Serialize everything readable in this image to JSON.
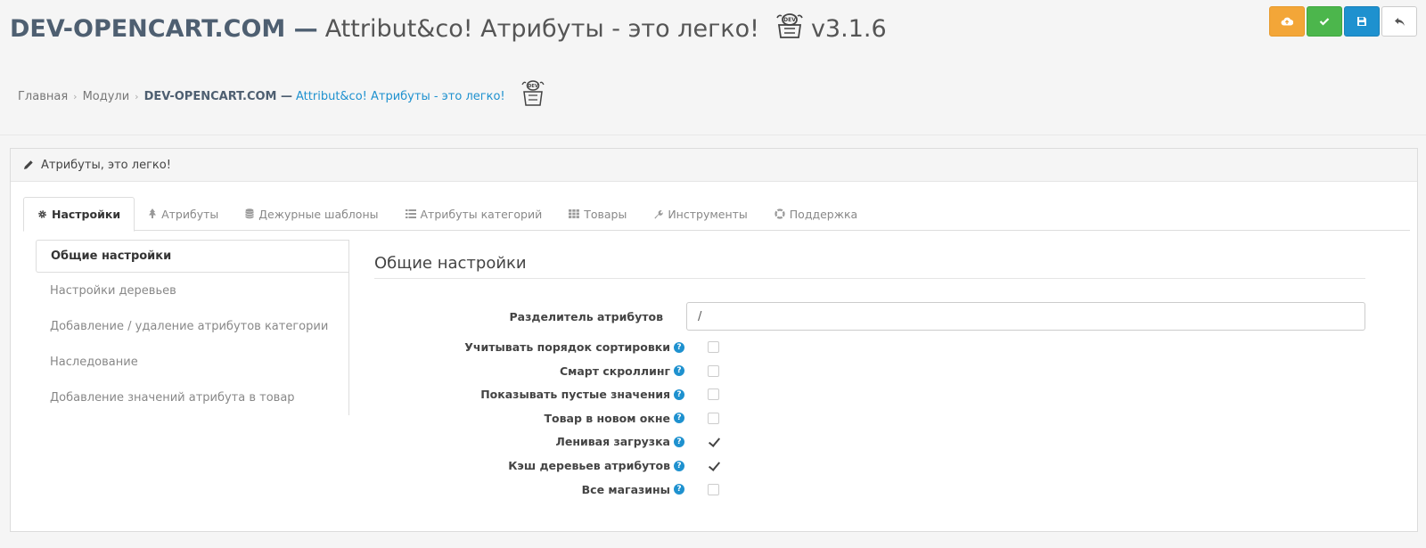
{
  "header": {
    "brand": "DEV-OPENCART.COM —",
    "module_name": "Attribut&co! Атрибуты - это легко!",
    "version": "v3.1.6",
    "logo_text": "DEV"
  },
  "actions": [
    {
      "name": "upload-button",
      "icon": "cloud-upload-icon",
      "color": "#f3a638"
    },
    {
      "name": "apply-button",
      "icon": "check-icon",
      "color": "#4cb64c"
    },
    {
      "name": "save-button",
      "icon": "save-icon",
      "color": "#1e91cf"
    },
    {
      "name": "back-button",
      "icon": "reply-icon",
      "color": "#ffffff"
    }
  ],
  "breadcrumb": {
    "home": "Главная",
    "modules": "Модули",
    "brand": "DEV-OPENCART.COM —",
    "current": "Attribut&co! Атрибуты - это легко!"
  },
  "panel": {
    "heading": "Атрибуты, это легко!"
  },
  "tabs": [
    {
      "label": "Настройки",
      "icon": "gear-icon",
      "active": true
    },
    {
      "label": "Атрибуты",
      "icon": "tree-icon"
    },
    {
      "label": "Дежурные шаблоны",
      "icon": "database-icon"
    },
    {
      "label": "Атрибуты категорий",
      "icon": "list-icon"
    },
    {
      "label": "Товары",
      "icon": "grid-icon"
    },
    {
      "label": "Инструменты",
      "icon": "wrench-icon"
    },
    {
      "label": "Поддержка",
      "icon": "lifebuoy-icon"
    }
  ],
  "sidenav": [
    {
      "label": "Общие настройки",
      "active": true
    },
    {
      "label": "Настройки деревьев"
    },
    {
      "label": "Добавление / удаление атрибутов категории"
    },
    {
      "label": "Наследование"
    },
    {
      "label": "Добавление значений атрибута в товар"
    }
  ],
  "content": {
    "title": "Общие настройки",
    "separator_label": "Разделитель атрибутов",
    "separator_value": "/",
    "help_glyph": "?",
    "settings": [
      {
        "label": "Учитывать порядок сортировки",
        "checked": false
      },
      {
        "label": "Смарт скроллинг",
        "checked": false
      },
      {
        "label": "Показывать пустые значения",
        "checked": false
      },
      {
        "label": "Товар в новом окне",
        "checked": false
      },
      {
        "label": "Ленивая загрузка",
        "checked": true
      },
      {
        "label": "Кэш деревьев атрибутов",
        "checked": true
      },
      {
        "label": "Все магазины",
        "checked": false
      }
    ]
  },
  "colors": {
    "accent": "#1e91cf",
    "brand": "#4e5f71"
  }
}
